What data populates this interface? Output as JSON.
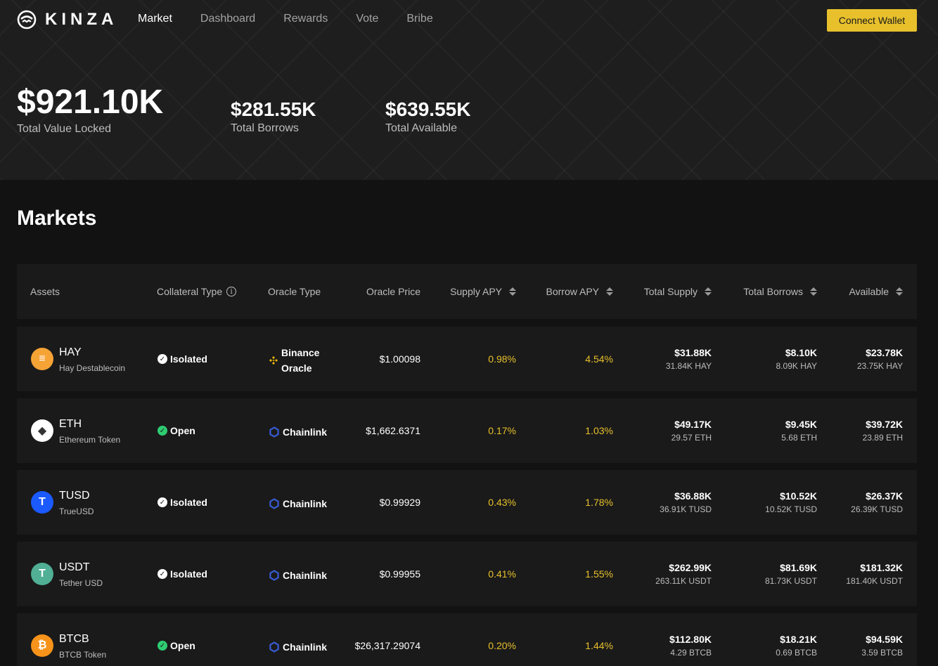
{
  "app": {
    "logo_text": "KINZA",
    "nav": [
      {
        "label": "Market",
        "active": true
      },
      {
        "label": "Dashboard",
        "active": false
      },
      {
        "label": "Rewards",
        "active": false
      },
      {
        "label": "Vote",
        "active": false
      },
      {
        "label": "Bribe",
        "active": false
      }
    ],
    "connect_wallet_label": "Connect Wallet",
    "accent": "#e7c02c"
  },
  "stats": {
    "tvl": {
      "value": "$921.10K",
      "label": "Total Value Locked"
    },
    "borrows": {
      "value": "$281.55K",
      "label": "Total Borrows"
    },
    "available": {
      "value": "$639.55K",
      "label": "Total Available"
    }
  },
  "markets": {
    "title": "Markets",
    "columns": {
      "assets": "Assets",
      "collateral_type": "Collateral Type",
      "oracle_type": "Oracle Type",
      "oracle_price": "Oracle Price",
      "supply_apy": "Supply APY",
      "borrow_apy": "Borrow APY",
      "total_supply": "Total Supply",
      "total_borrows": "Total Borrows",
      "available": "Available"
    },
    "rows": [
      {
        "symbol": "HAY",
        "name": "Hay Destablecoin",
        "icon": "hay-icon",
        "icon_color": "#f6a336",
        "collateral": "Isolated",
        "collateral_icon": "check-circle-icon",
        "collateral_color": "#ffffff",
        "oracle_line1": "Binance",
        "oracle_line2": "Oracle",
        "oracle_icon": "binance-icon",
        "oracle_price": "$1.00098",
        "supply_apy": "0.98%",
        "borrow_apy": "4.54%",
        "total_supply": "$31.88K",
        "total_supply_sub": "31.84K HAY",
        "total_borrows": "$8.10K",
        "total_borrows_sub": "8.09K HAY",
        "available": "$23.78K",
        "available_sub": "23.75K HAY"
      },
      {
        "symbol": "ETH",
        "name": "Ethereum Token",
        "icon": "eth-icon",
        "icon_color": "#ffffff",
        "collateral": "Open",
        "collateral_icon": "check-circle-icon",
        "collateral_color": "#2ecc71",
        "oracle_line1": "Chainlink",
        "oracle_line2": "",
        "oracle_icon": "chainlink-icon",
        "oracle_price": "$1,662.6371",
        "supply_apy": "0.17%",
        "borrow_apy": "1.03%",
        "total_supply": "$49.17K",
        "total_supply_sub": "29.57 ETH",
        "total_borrows": "$9.45K",
        "total_borrows_sub": "5.68 ETH",
        "available": "$39.72K",
        "available_sub": "23.89 ETH"
      },
      {
        "symbol": "TUSD",
        "name": "TrueUSD",
        "icon": "tusd-icon",
        "icon_color": "#1a5aff",
        "collateral": "Isolated",
        "collateral_icon": "check-circle-icon",
        "collateral_color": "#ffffff",
        "oracle_line1": "Chainlink",
        "oracle_line2": "",
        "oracle_icon": "chainlink-icon",
        "oracle_price": "$0.99929",
        "supply_apy": "0.43%",
        "borrow_apy": "1.78%",
        "total_supply": "$36.88K",
        "total_supply_sub": "36.91K TUSD",
        "total_borrows": "$10.52K",
        "total_borrows_sub": "10.52K TUSD",
        "available": "$26.37K",
        "available_sub": "26.39K TUSD"
      },
      {
        "symbol": "USDT",
        "name": "Tether USD",
        "icon": "usdt-icon",
        "icon_color": "#50af95",
        "collateral": "Isolated",
        "collateral_icon": "check-circle-icon",
        "collateral_color": "#ffffff",
        "oracle_line1": "Chainlink",
        "oracle_line2": "",
        "oracle_icon": "chainlink-icon",
        "oracle_price": "$0.99955",
        "supply_apy": "0.41%",
        "borrow_apy": "1.55%",
        "total_supply": "$262.99K",
        "total_supply_sub": "263.11K USDT",
        "total_borrows": "$81.69K",
        "total_borrows_sub": "81.73K USDT",
        "available": "$181.32K",
        "available_sub": "181.40K USDT"
      },
      {
        "symbol": "BTCB",
        "name": "BTCB Token",
        "icon": "btcb-icon",
        "icon_color": "#f7931a",
        "collateral": "Open",
        "collateral_icon": "check-circle-icon",
        "collateral_color": "#2ecc71",
        "oracle_line1": "Chainlink",
        "oracle_line2": "",
        "oracle_icon": "chainlink-icon",
        "oracle_price": "$26,317.29074",
        "supply_apy": "0.20%",
        "borrow_apy": "1.44%",
        "total_supply": "$112.80K",
        "total_supply_sub": "4.29 BTCB",
        "total_borrows": "$18.21K",
        "total_borrows_sub": "0.69 BTCB",
        "available": "$94.59K",
        "available_sub": "3.59 BTCB"
      }
    ]
  }
}
